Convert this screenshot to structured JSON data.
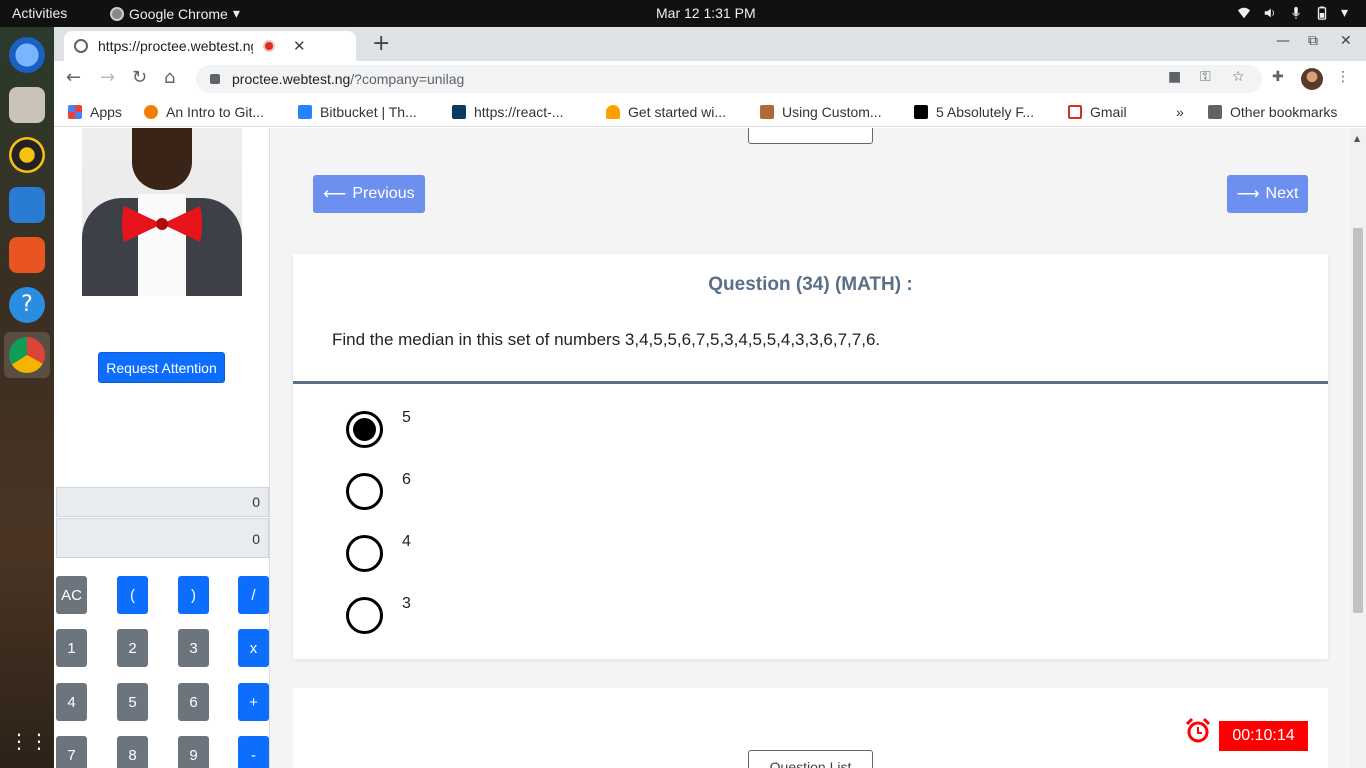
{
  "topbar": {
    "activities": "Activities",
    "app_name": "Google Chrome",
    "clock": "Mar 12   1:31 PM"
  },
  "browser": {
    "tab_title": "https://proctee.webtest.ng/?company=unilag",
    "url_host": "proctee.webtest.ng",
    "url_path": "/?company=unilag",
    "bookmarks": [
      {
        "label": "Apps",
        "color": "#4285f4"
      },
      {
        "label": "An Intro to Git...",
        "color": "#f57c00"
      },
      {
        "label": "Bitbucket | Th...",
        "color": "#2684ff"
      },
      {
        "label": "https://react-...",
        "color": "#1a73e8"
      },
      {
        "label": "Get started wi...",
        "color": "#ffa000"
      },
      {
        "label": "Using Custom...",
        "color": "#b06a3a"
      },
      {
        "label": "5 Absolutely F...",
        "color": "#000000"
      },
      {
        "label": "Gmail",
        "color": "#d93025"
      }
    ],
    "more_bookmarks": "»",
    "other_bookmarks": "Other bookmarks"
  },
  "sidebar": {
    "request_attention": "Request Attention",
    "calc_display_top": "0",
    "calc_display_bottom": "0",
    "calc_keys": [
      {
        "label": "AC",
        "style": "gray"
      },
      {
        "label": "(",
        "style": "blue"
      },
      {
        "label": ")",
        "style": "blue"
      },
      {
        "label": "/",
        "style": "blue"
      },
      {
        "label": "1",
        "style": "gray"
      },
      {
        "label": "2",
        "style": "gray"
      },
      {
        "label": "3",
        "style": "gray"
      },
      {
        "label": "x",
        "style": "blue"
      },
      {
        "label": "4",
        "style": "gray"
      },
      {
        "label": "5",
        "style": "gray"
      },
      {
        "label": "6",
        "style": "gray"
      },
      {
        "label": "+",
        "style": "blue"
      },
      {
        "label": "7",
        "style": "gray"
      },
      {
        "label": "8",
        "style": "gray"
      },
      {
        "label": "9",
        "style": "gray"
      },
      {
        "label": "-",
        "style": "blue"
      }
    ]
  },
  "quiz": {
    "previous_label": "Previous",
    "next_label": "Next",
    "question_title": "Question (34) (MATH) :",
    "question_text": "Find the median in this set of numbers 3,4,5,5,6,7,5,3,4,5,5,4,3,3,6,7,7,6.",
    "options": [
      {
        "label": "5",
        "selected": true
      },
      {
        "label": "6",
        "selected": false
      },
      {
        "label": "4",
        "selected": false
      },
      {
        "label": "3",
        "selected": false
      }
    ],
    "question_list_label": "Question List",
    "timer": "00:10:14",
    "accent": "#6d8ff0",
    "timer_color": "#fe0000"
  }
}
